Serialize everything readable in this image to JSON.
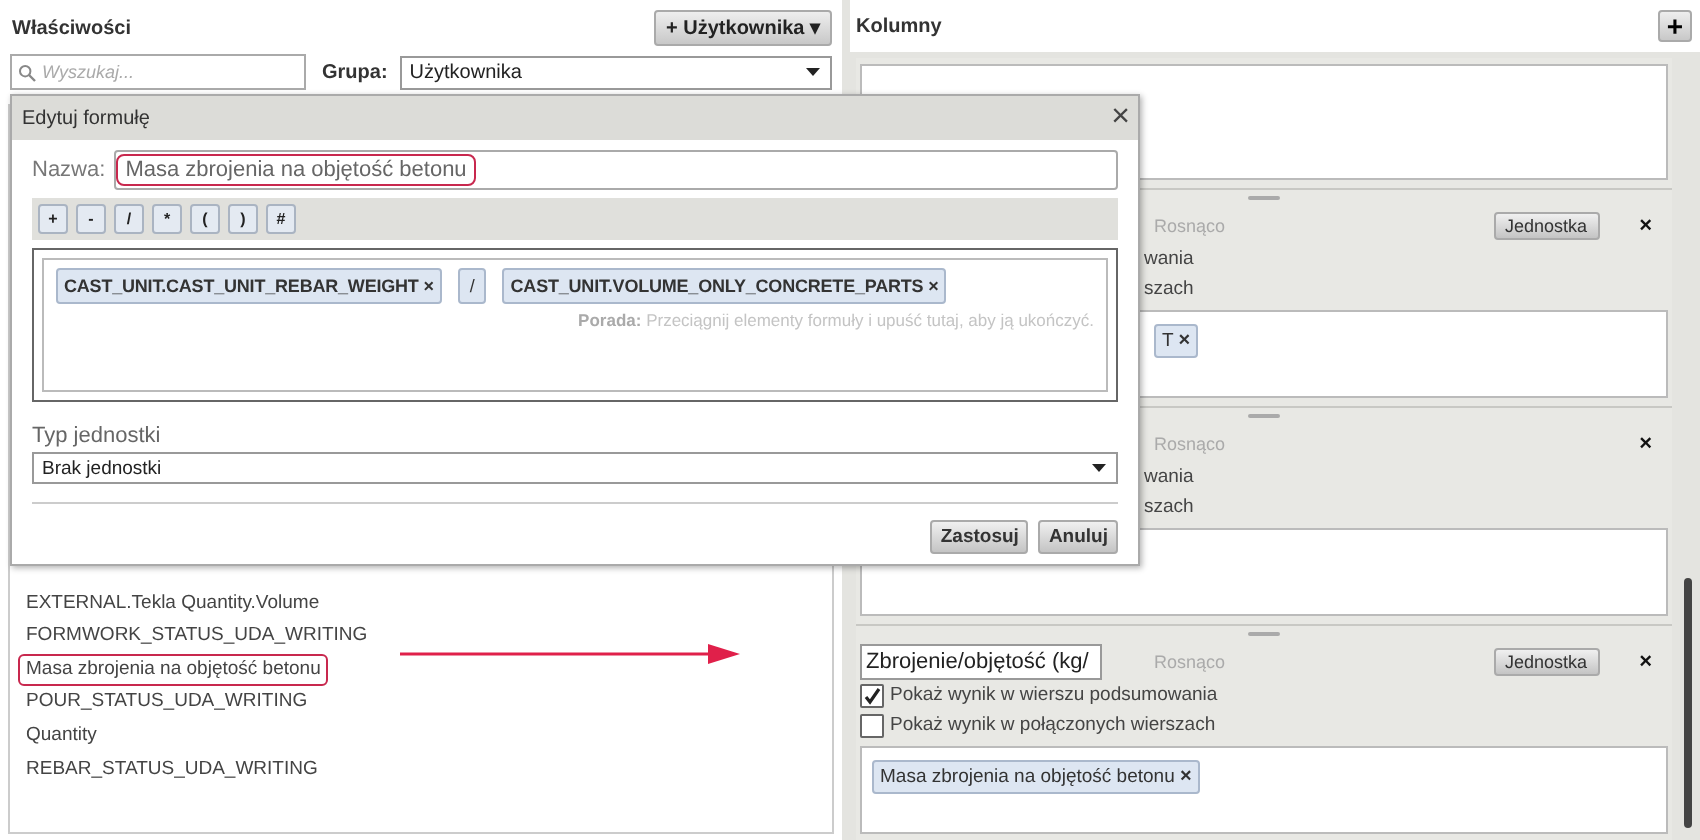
{
  "properties": {
    "title": "Właściwości",
    "add_button": "Użytkownika",
    "add_icon": "+",
    "caret": "▾",
    "search": {
      "placeholder": "Wyszukaj..."
    },
    "group_label": "Grupa:",
    "group_value": "Użytkownika",
    "items": [
      {
        "label": "EXTERNAL.Tekla Quantity.Volume",
        "highlighted": false
      },
      {
        "label": "FORMWORK_STATUS_UDA_WRITING",
        "highlighted": false
      },
      {
        "label": "Masa zbrojenia na objętość betonu",
        "highlighted": true
      },
      {
        "label": "POUR_STATUS_UDA_WRITING",
        "highlighted": false
      },
      {
        "label": "Quantity",
        "highlighted": false
      },
      {
        "label": "REBAR_STATUS_UDA_WRITING",
        "highlighted": false
      }
    ]
  },
  "columns": {
    "title": "Kolumny",
    "add_icon": "+",
    "cards": [
      {
        "kind": "tags_only"
      },
      {
        "kind": "covered",
        "sort": "Rosnąco",
        "unit_button": "Jednostka",
        "remove": "×",
        "options": [
          {
            "label": "wania"
          },
          {
            "label": "szach"
          }
        ],
        "tags": [
          {
            "text": "T",
            "remove": "×"
          }
        ]
      },
      {
        "kind": "covered",
        "sort": "Rosnąco",
        "remove": "×",
        "options": [
          {
            "label": "wania"
          },
          {
            "label": "szach"
          }
        ]
      },
      {
        "kind": "full",
        "name": "Zbrojenie/objętość (kg/",
        "sort": "Rosnąco",
        "unit_button": "Jednostka",
        "remove": "×",
        "options": [
          {
            "label": "Pokaż wynik w wierszu podsumowania",
            "checked": true
          },
          {
            "label": "Pokaż wynik w połączonych wierszach",
            "checked": false
          }
        ],
        "tags": [
          {
            "text": "Masa zbrojenia na objętość betonu",
            "remove": "×"
          }
        ]
      }
    ]
  },
  "dialog": {
    "title": "Edytuj formułę",
    "close": "×",
    "name_label": "Nazwa:",
    "name_value": "Masa zbrojenia na objętość betonu",
    "operators": [
      "+",
      "-",
      "/",
      "*",
      "(",
      ")",
      "#"
    ],
    "formula": [
      {
        "kind": "field",
        "text": "CAST_UNIT.CAST_UNIT_REBAR_WEIGHT",
        "remove": "×"
      },
      {
        "kind": "operator",
        "text": "/"
      },
      {
        "kind": "field",
        "text": "CAST_UNIT.VOLUME_ONLY_CONCRETE_PARTS",
        "remove": "×"
      }
    ],
    "hint": "**Porada:** Przeciągnij elementy formuły i upuść tutaj, aby ją ukończyć.",
    "unit_label": "Typ jednostki",
    "unit_value": "Brak jednostki",
    "buttons": [
      "Zastosuj",
      "Anuluj"
    ]
  }
}
